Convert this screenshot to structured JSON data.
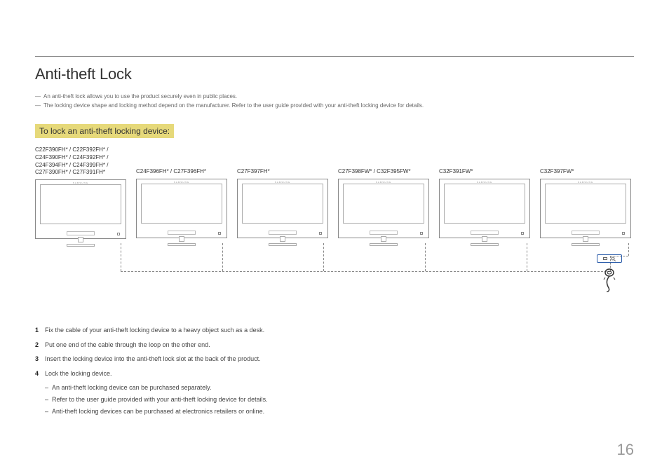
{
  "title": "Anti-theft Lock",
  "notes": [
    "An anti-theft lock allows you to use the product securely even in public places.",
    "The locking device shape and locking method depend on the manufacturer. Refer to the user guide provided with your anti-theft locking device for details."
  ],
  "subheading": "To lock an anti-theft locking device:",
  "models": [
    "C22F390FH* / C22F392FH* / C24F390FH* / C24F392FH* / C24F394FH* / C24F399FH* / C27F390FH* / C27F391FH*",
    "C24F396FH* / C27F396FH*",
    "C27F397FH*",
    "C27F398FW* / C32F395FW*",
    "C32F391FW*",
    "C32F397FW*"
  ],
  "brand": "SAMSUNG",
  "steps": [
    "Fix the cable of your anti-theft locking device to a heavy object such as a desk.",
    "Put one end of the cable through the loop on the other end.",
    "Insert the locking device into the anti-theft lock slot at the back of the product.",
    "Lock the locking device."
  ],
  "bullets": [
    "An anti-theft locking device can be purchased separately.",
    "Refer to the user guide provided with your anti-theft locking device for details.",
    "Anti-theft locking devices can be purchased at electronics retailers or online."
  ],
  "page_number": "16"
}
